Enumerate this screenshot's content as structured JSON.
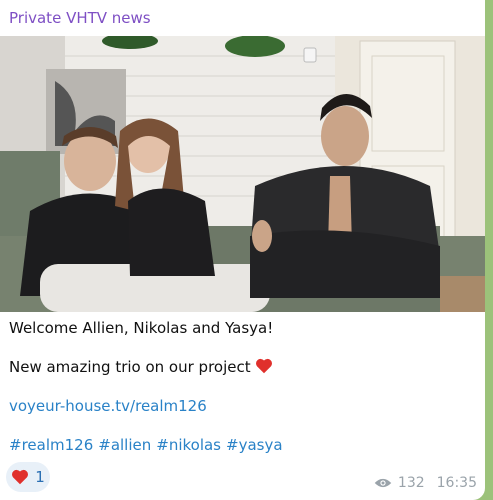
{
  "channel": {
    "name": "Private VHTV news"
  },
  "post": {
    "line1": "Welcome Allien, Nikolas and Yasya!",
    "line2": "New amazing trio on our project",
    "link": "voyeur-house.tv/realm126",
    "hashtags": [
      "#realm126",
      "#allien",
      "#nikolas",
      "#yasya"
    ]
  },
  "reaction": {
    "icon": "heart-icon",
    "count": "1"
  },
  "meta": {
    "views": "132",
    "time": "16:35"
  },
  "colors": {
    "channel_name": "#7e4fc4",
    "link": "#2a82c7",
    "chat_bg": "#9cc27a",
    "heart": "#e0302c"
  }
}
